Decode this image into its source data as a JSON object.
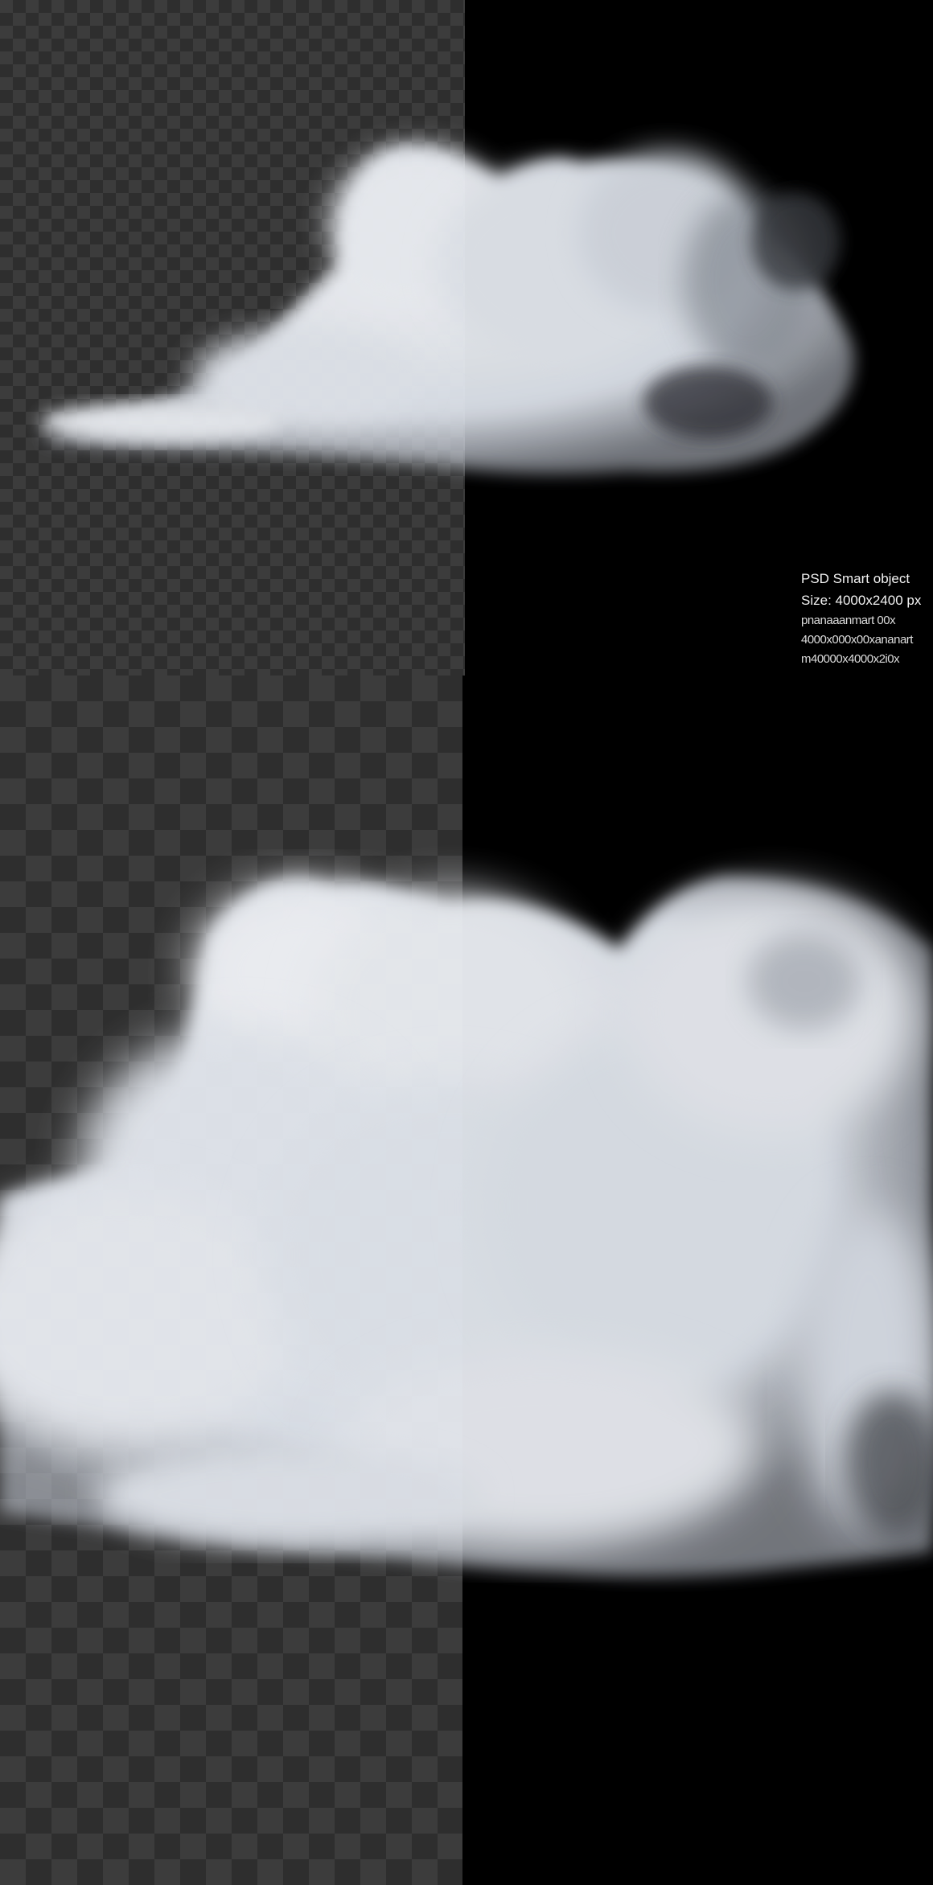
{
  "info": {
    "line1": "PSD Smart object",
    "line2": "Size: 4000x2400 px",
    "line3": "pnanaaanmart 00x",
    "line4": "4000x000x00xananart",
    "line5": "m40000x4000x2i0x"
  },
  "colors": {
    "background": "#000000",
    "checker_light": "#3c3c3c",
    "checker_dark": "#2e2e2e",
    "smoke": "#e6e9ef"
  }
}
